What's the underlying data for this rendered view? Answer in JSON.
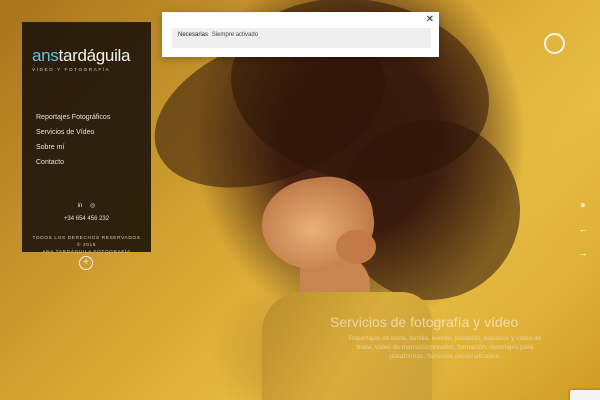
{
  "brand": {
    "logo_prefix": "ans",
    "logo_name": "tardáguila",
    "logo_tagline": "VÍDEO Y FOTOGRAFÍA"
  },
  "menu": [
    {
      "label": "Reportajes Fotográficos"
    },
    {
      "label": "Servicios de Vídeo"
    },
    {
      "label": "Sobre mí"
    },
    {
      "label": "Contacto"
    }
  ],
  "social": {
    "linkedin_icon": "in",
    "instagram_icon": "◎"
  },
  "contact": {
    "phone": "+34 654 456 232"
  },
  "footer": {
    "rights": "TODOS LOS DERECHOS RESERVADOS",
    "year": "© 2018",
    "company": "ANA TARDÁGUILA FOTOGRAFÍA"
  },
  "plus_button": "+",
  "slider_controls": {
    "pause": "⏸",
    "prev": "←",
    "next": "→"
  },
  "cookie_modal": {
    "close_label": "✕",
    "category": "Necesarias",
    "status": "Siempre activado"
  },
  "hero": {
    "title": "Servicios de fotografía y vídeo",
    "description": "Reportajes de boda, familia, evento, producto, espacios y vídeo de boda, vídeo de marca/corporativo, formación, reportajes para plataformas. Servicios personalizados."
  },
  "colors": {
    "accent": "#62c3d9",
    "sidebar_bg": "#181008",
    "background": "#d6a632"
  }
}
